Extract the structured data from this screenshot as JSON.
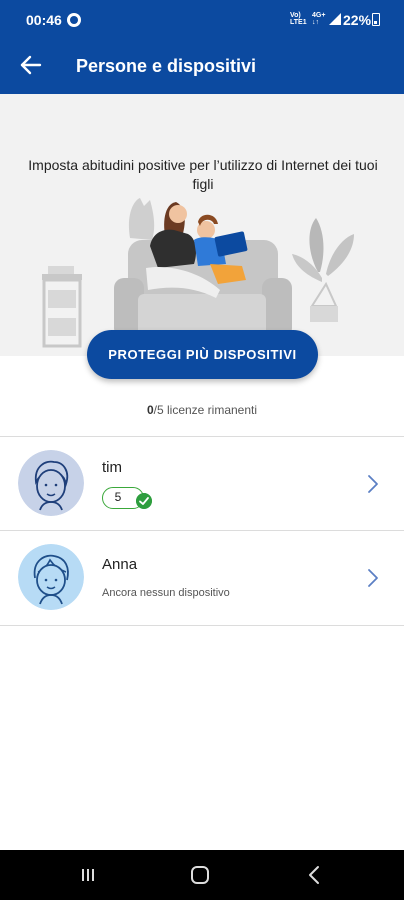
{
  "status_bar": {
    "time": "00:46",
    "net_left": "VoLTE",
    "net_right": "LTE",
    "battery": "22%"
  },
  "header": {
    "title": "Persone e dispositivi",
    "back_icon": "arrow-left-icon",
    "background_color": "#0c4aa0"
  },
  "hero": {
    "text": "Imposta abitudini positive per l’utilizzo di Internet dei tuoi figli"
  },
  "protect_button": {
    "label": "PROTEGGI PIÙ DISPOSITIVI"
  },
  "licenses": {
    "count": "0",
    "text": "/5 licenze rimanenti"
  },
  "profiles": [
    {
      "name": "tim",
      "device_count": "5",
      "status_icon": "check-circle-icon",
      "avatar_icon": "boy-avatar-icon"
    },
    {
      "name": "Anna",
      "subtitle": "Ancora nessun dispositivo",
      "avatar_icon": "child-avatar-icon"
    }
  ],
  "colors": {
    "primary": "#0c4aa0",
    "success": "#2e9e3e",
    "chevron": "#5b7fc4"
  }
}
